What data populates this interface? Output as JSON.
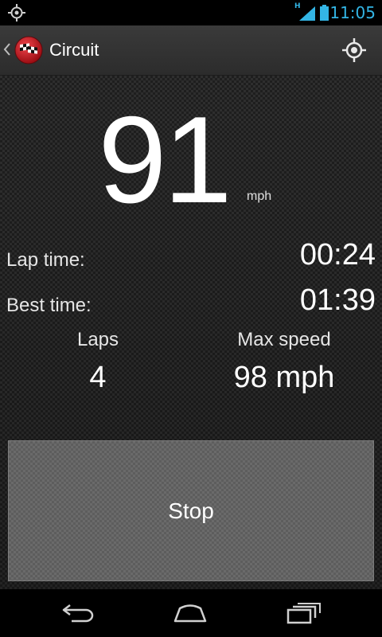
{
  "status_bar": {
    "network_type": "H",
    "time": "11:05",
    "icons": [
      "gps-icon",
      "signal-icon",
      "battery-icon"
    ]
  },
  "action_bar": {
    "title": "Circuit",
    "icons": [
      "up-caret-icon",
      "checkered-flag-icon",
      "locate-icon"
    ]
  },
  "speed": {
    "value": "91",
    "unit": "mph"
  },
  "lap_time": {
    "label": "Lap time:",
    "value": "00:24"
  },
  "best_time": {
    "label": "Best time:",
    "value": "01:39"
  },
  "laps": {
    "label": "Laps",
    "value": "4"
  },
  "max_speed": {
    "label": "Max speed",
    "value": "98 mph"
  },
  "stop_button": {
    "label": "Stop"
  },
  "nav_bar": {
    "icons": [
      "back-icon",
      "home-icon",
      "recents-icon"
    ]
  },
  "colors": {
    "status_accent": "#33b5e5",
    "app_icon_red": "#c8141c",
    "button_gray": "#6a6a6a"
  }
}
